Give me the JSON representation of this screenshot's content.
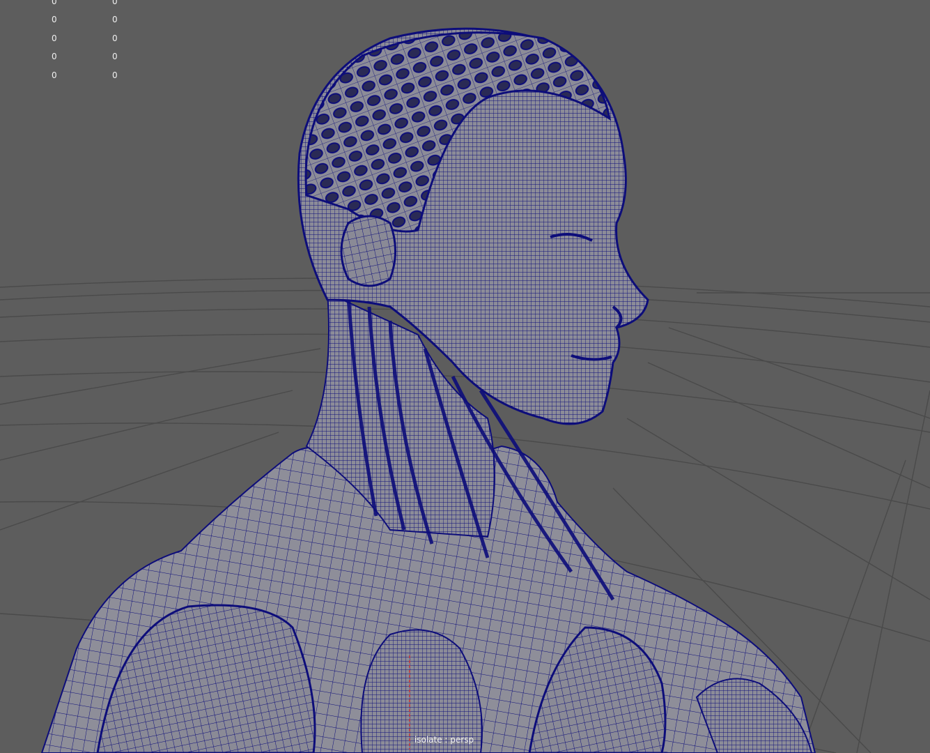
{
  "viewport": {
    "panel_label": "isolate : persp",
    "background_color": "#5d5d5d",
    "grid_color": "#4a4a4a",
    "wire_color": "#0d0d7a",
    "surface_color": "#8c8c98",
    "axis_color": "#c83232"
  },
  "heads_up_display": {
    "rows": [
      {
        "col1": "0",
        "col2": "0"
      },
      {
        "col1": "0",
        "col2": "0"
      },
      {
        "col1": "0",
        "col2": "0"
      },
      {
        "col1": "0",
        "col2": "0"
      },
      {
        "col1": "0",
        "col2": "0"
      }
    ]
  },
  "scene_objects": [
    {
      "name": "head-mesh",
      "type": "polygon-wireframe"
    },
    {
      "name": "neck-cables-mesh",
      "type": "polygon-wireframe"
    },
    {
      "name": "torso-mesh",
      "type": "polygon-wireframe"
    },
    {
      "name": "ground-grid",
      "type": "grid"
    }
  ]
}
